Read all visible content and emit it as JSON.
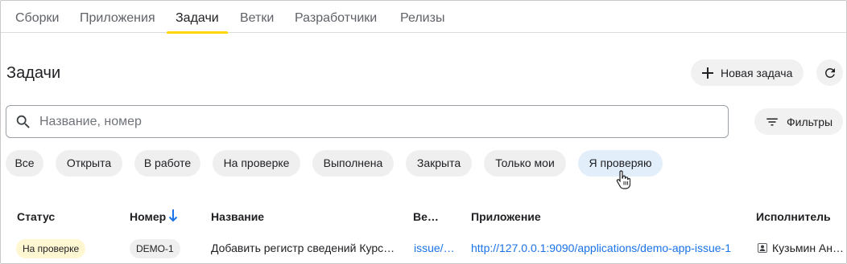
{
  "nav": {
    "tabs": [
      {
        "label": "Сборки"
      },
      {
        "label": "Приложения"
      },
      {
        "label": "Задачи",
        "active": true
      },
      {
        "label": "Ветки"
      },
      {
        "label": "Разработчики"
      },
      {
        "label": "Релизы"
      }
    ]
  },
  "header": {
    "title": "Задачи",
    "new_task_label": "Новая задача",
    "refresh_icon": "refresh-icon"
  },
  "search": {
    "placeholder": "Название, номер",
    "value": "",
    "filters_label": "Фильтры"
  },
  "chips": [
    {
      "label": "Все"
    },
    {
      "label": "Открыта"
    },
    {
      "label": "В работе"
    },
    {
      "label": "На проверке"
    },
    {
      "label": "Выполнена"
    },
    {
      "label": "Закрыта"
    },
    {
      "label": "Только мои"
    },
    {
      "label": "Я проверяю",
      "selected": true
    }
  ],
  "table": {
    "columns": [
      "Статус",
      "Номер",
      "Название",
      "Ве…",
      "Приложение",
      "Исполнитель"
    ],
    "sort_column": "Номер",
    "sort_direction": "desc",
    "rows": [
      {
        "status": "На проверке",
        "number": "DEMO-1",
        "name": "Добавить регистр сведений Курс…",
        "branch": "issue/…",
        "application": "http://127.0.0.1:9090/applications/demo-app-issue-1",
        "assignee": "Кузьмин Ан…"
      }
    ]
  },
  "colors": {
    "active_tab_underline": "#ffd600",
    "link": "#1a73e8",
    "status_review_bg": "#fff6d2",
    "selected_chip_bg": "#e3eefb"
  }
}
